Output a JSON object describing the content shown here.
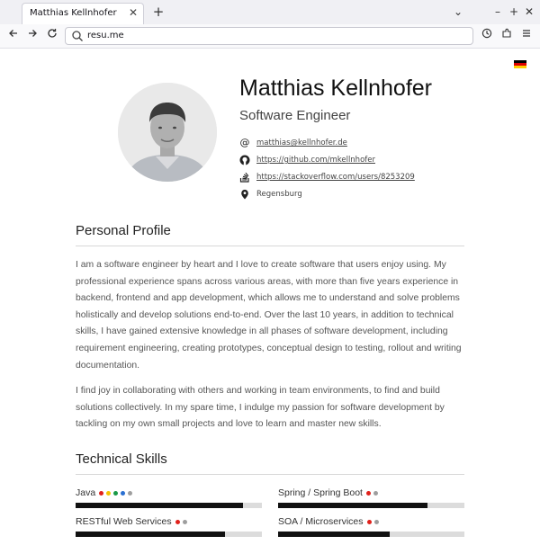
{
  "browser": {
    "tab_title": "Matthias Kellnhofer",
    "tab_close": "✕",
    "new_tab": "+",
    "url": "resu.me",
    "win_min": "–",
    "win_max": "+",
    "win_close": "✕",
    "tabs_list": "⌄"
  },
  "header": {
    "name": "Matthias Kellnhofer",
    "job_title": "Software Engineer",
    "contacts": [
      {
        "icon": "at-icon",
        "text": "matthias@kellnhofer.de",
        "link": true
      },
      {
        "icon": "github-icon",
        "text": "https://github.com/mkellnhofer",
        "link": true
      },
      {
        "icon": "stackoverflow-icon",
        "text": "https://stackoverflow.com/users/8253209",
        "link": true
      },
      {
        "icon": "location-pin-icon",
        "text": "Regensburg",
        "link": false
      }
    ],
    "language_flag_colors": [
      "#000000",
      "#dd0000",
      "#ffce00"
    ]
  },
  "profile": {
    "title": "Personal Profile",
    "paragraph_1": "I am a software engineer by heart and I love to create software that users enjoy using. My professional experience spans across various areas, with more than five years experience in backend, frontend and app development, which allows me to understand and solve problems holistically and develop solutions end-to-end. Over the last 10 years, in addition to technical skills, I have gained extensive knowledge in all phases of software development, including requirement engineering, creating prototypes, conceptual design to testing, rollout and writing documentation.",
    "paragraph_2": "I find joy in collaborating with others and working in team environments, to find and build solutions collectively. In my spare time, I indulge my passion for software development by tackling on my own small projects and love to learn and master new skills."
  },
  "skills": {
    "title": "Technical Skills",
    "items": [
      {
        "label": "Java",
        "dots": [
          "#e0211b",
          "#f5c400",
          "#1a9a47",
          "#2a6fd1",
          "#9e9e9e"
        ],
        "level": 0.9
      },
      {
        "label": "Spring / Spring Boot",
        "dots": [
          "#e0211b",
          "#9e9e9e"
        ],
        "level": 0.8
      },
      {
        "label": "RESTful Web Services",
        "dots": [
          "#e0211b",
          "#9e9e9e"
        ],
        "level": 0.8
      },
      {
        "label": "SOA / Microservices",
        "dots": [
          "#e0211b",
          "#9e9e9e"
        ],
        "level": 0.6
      }
    ]
  }
}
